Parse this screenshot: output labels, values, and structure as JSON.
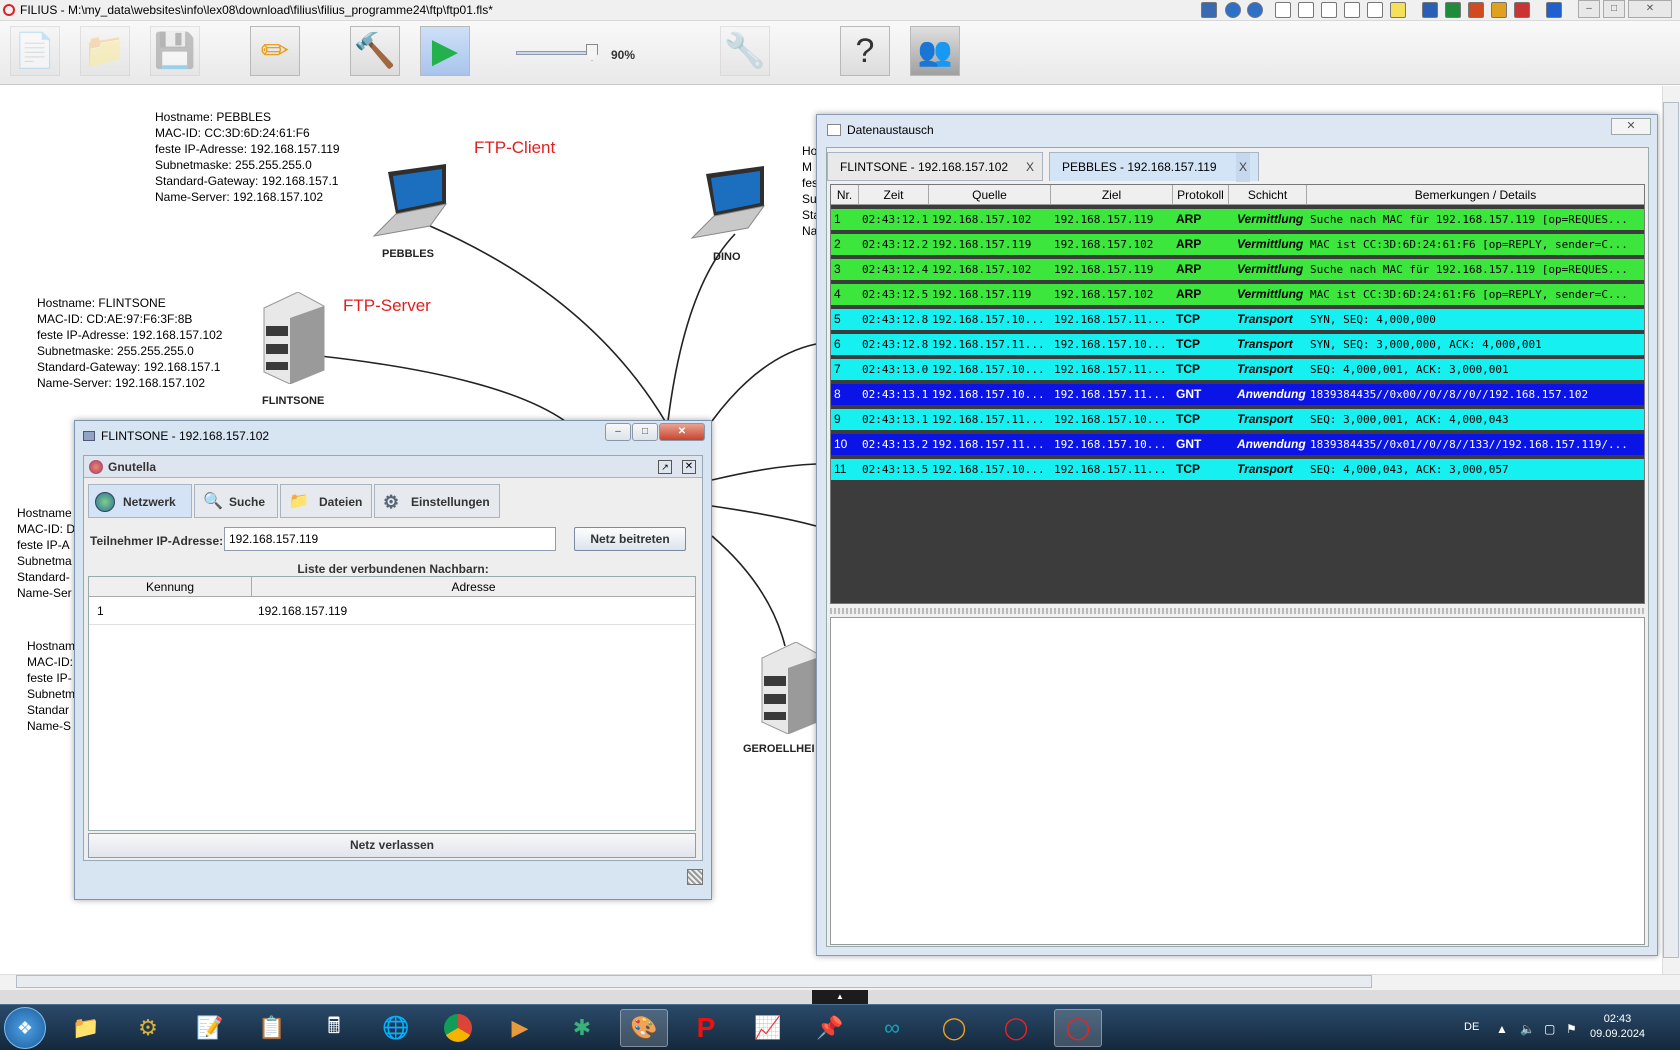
{
  "app": {
    "title": "FILIUS - M:\\my_data\\websites\\info\\lex08\\download\\filius\\filius_programme24\\ftp\\ftp01.fls*"
  },
  "toolbar": {
    "speed_value": "90%",
    "speed_fraction": 0.9
  },
  "canvas": {
    "labels": {
      "ftp_client": "FTP-Client",
      "ftp_server": "FTP-Server"
    },
    "nodes": {
      "pebbles": "PEBBLES",
      "dino": "DINO",
      "flintsone": "FLINTSONE",
      "geroellheimer": "GEROELLHEI"
    },
    "info_pebbles": "Hostname: PEBBLES\nMAC-ID: CC:3D:6D:24:61:F6\nfeste IP-Adresse: 192.168.157.119\nSubnetmaske: 255.255.255.0\nStandard-Gateway: 192.168.157.1\nName-Server: 192.168.157.102",
    "info_flintsone": "Hostname: FLINTSONE\nMAC-ID: CD:AE:97:F6:3F:8B\nfeste IP-Adresse: 192.168.157.102\nSubnetmaske: 255.255.255.0\nStandard-Gateway: 192.168.157.1\nName-Server: 192.168.157.102",
    "info_dino_partial": "Ho\nM\nfes\nSu\nSta\nNa",
    "info_hidden1": "Hostname\nMAC-ID: D\nfeste IP-A\nSubnetma\nStandard-\nName-Ser",
    "info_hidden2": "Hostnam\nMAC-ID:\nfeste IP-\nSubnetm\nStandar\nName-S"
  },
  "exchange": {
    "title": "Datenaustausch",
    "tabs": [
      {
        "label": "FLINTSONE - 192.168.157.102",
        "close": "X"
      },
      {
        "label": "PEBBLES - 192.168.157.119",
        "close": "X"
      }
    ],
    "columns": [
      "Nr.",
      "Zeit",
      "Quelle",
      "Ziel",
      "Protokoll",
      "Schicht",
      "Bemerkungen / Details"
    ],
    "rows": [
      {
        "nr": "1",
        "zeit": "02:43:12.1...",
        "quelle": "192.168.157.102",
        "ziel": "192.168.157.119",
        "proto": "ARP",
        "schicht": "Vermittlung",
        "details": "Suche nach MAC für 192.168.157.119 [op=REQUES...",
        "color": "#3ce63c",
        "text": "#000000"
      },
      {
        "nr": "2",
        "zeit": "02:43:12.2...",
        "quelle": "192.168.157.119",
        "ziel": "192.168.157.102",
        "proto": "ARP",
        "schicht": "Vermittlung",
        "details": "MAC ist CC:3D:6D:24:61:F6 [op=REPLY, sender=C...",
        "color": "#3ce63c",
        "text": "#000000"
      },
      {
        "nr": "3",
        "zeit": "02:43:12.4...",
        "quelle": "192.168.157.102",
        "ziel": "192.168.157.119",
        "proto": "ARP",
        "schicht": "Vermittlung",
        "details": "Suche nach MAC für 192.168.157.119 [op=REQUES...",
        "color": "#3ce63c",
        "text": "#000000"
      },
      {
        "nr": "4",
        "zeit": "02:43:12.5...",
        "quelle": "192.168.157.119",
        "ziel": "192.168.157.102",
        "proto": "ARP",
        "schicht": "Vermittlung",
        "details": "MAC ist CC:3D:6D:24:61:F6 [op=REPLY, sender=C...",
        "color": "#3ce63c",
        "text": "#000000"
      },
      {
        "nr": "5",
        "zeit": "02:43:12.8...",
        "quelle": "192.168.157.10...",
        "ziel": "192.168.157.11...",
        "proto": "TCP",
        "schicht": "Transport",
        "details": "SYN, SEQ: 4,000,000",
        "color": "#16f0f0",
        "text": "#000000"
      },
      {
        "nr": "6",
        "zeit": "02:43:12.8...",
        "quelle": "192.168.157.11...",
        "ziel": "192.168.157.10...",
        "proto": "TCP",
        "schicht": "Transport",
        "details": "SYN, SEQ: 3,000,000, ACK: 4,000,001",
        "color": "#16f0f0",
        "text": "#000000"
      },
      {
        "nr": "7",
        "zeit": "02:43:13.0...",
        "quelle": "192.168.157.10...",
        "ziel": "192.168.157.11...",
        "proto": "TCP",
        "schicht": "Transport",
        "details": "SEQ: 4,000,001, ACK: 3,000,001",
        "color": "#16f0f0",
        "text": "#000000"
      },
      {
        "nr": "8",
        "zeit": "02:43:13.1...",
        "quelle": "192.168.157.10...",
        "ziel": "192.168.157.11...",
        "proto": "GNT",
        "schicht": "Anwendung",
        "details": "1839384435//0x00//0//8//0//192.168.157.102",
        "color": "#0a14e6",
        "text": "#ffffff"
      },
      {
        "nr": "9",
        "zeit": "02:43:13.1...",
        "quelle": "192.168.157.11...",
        "ziel": "192.168.157.10...",
        "proto": "TCP",
        "schicht": "Transport",
        "details": "SEQ: 3,000,001, ACK: 4,000,043",
        "color": "#16f0f0",
        "text": "#000000"
      },
      {
        "nr": "10",
        "zeit": "02:43:13.2...",
        "quelle": "192.168.157.11...",
        "ziel": "192.168.157.10...",
        "proto": "GNT",
        "schicht": "Anwendung",
        "details": "1839384435//0x01//0//8//133//192.168.157.119/...",
        "color": "#0a14e6",
        "text": "#ffffff"
      },
      {
        "nr": "11",
        "zeit": "02:43:13.5...",
        "quelle": "192.168.157.10...",
        "ziel": "192.168.157.11...",
        "proto": "TCP",
        "schicht": "Transport",
        "details": "SEQ: 4,000,043, ACK: 3,000,057",
        "color": "#16f0f0",
        "text": "#000000"
      }
    ]
  },
  "flintsone_window": {
    "title": "FLINTSONE - 192.168.157.102",
    "app_title": "Gnutella",
    "tabs": [
      "Netzwerk",
      "Suche",
      "Dateien",
      "Einstellungen"
    ],
    "ip_label": "Teilnehmer IP-Adresse:",
    "ip_value": "192.168.157.119",
    "join_button": "Netz beitreten",
    "list_caption": "Liste der verbundenen Nachbarn:",
    "table_columns": [
      "Kennung",
      "Adresse"
    ],
    "table_rows": [
      {
        "kennung": "1",
        "adresse": "192.168.157.119"
      }
    ],
    "leave_button": "Netz verlassen"
  },
  "taskbar": {
    "language": "DE",
    "time": "02:43",
    "date": "09.09.2024"
  }
}
